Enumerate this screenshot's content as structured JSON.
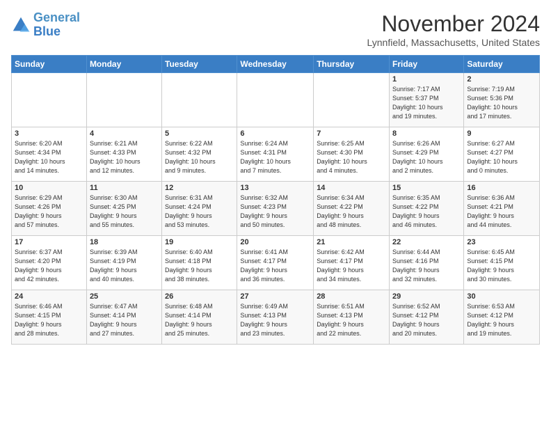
{
  "logo": {
    "line1": "General",
    "line2": "Blue"
  },
  "title": "November 2024",
  "location": "Lynnfield, Massachusetts, United States",
  "days_header": [
    "Sunday",
    "Monday",
    "Tuesday",
    "Wednesday",
    "Thursday",
    "Friday",
    "Saturday"
  ],
  "weeks": [
    [
      {
        "day": "",
        "info": ""
      },
      {
        "day": "",
        "info": ""
      },
      {
        "day": "",
        "info": ""
      },
      {
        "day": "",
        "info": ""
      },
      {
        "day": "",
        "info": ""
      },
      {
        "day": "1",
        "info": "Sunrise: 7:17 AM\nSunset: 5:37 PM\nDaylight: 10 hours\nand 19 minutes."
      },
      {
        "day": "2",
        "info": "Sunrise: 7:19 AM\nSunset: 5:36 PM\nDaylight: 10 hours\nand 17 minutes."
      }
    ],
    [
      {
        "day": "3",
        "info": "Sunrise: 6:20 AM\nSunset: 4:34 PM\nDaylight: 10 hours\nand 14 minutes."
      },
      {
        "day": "4",
        "info": "Sunrise: 6:21 AM\nSunset: 4:33 PM\nDaylight: 10 hours\nand 12 minutes."
      },
      {
        "day": "5",
        "info": "Sunrise: 6:22 AM\nSunset: 4:32 PM\nDaylight: 10 hours\nand 9 minutes."
      },
      {
        "day": "6",
        "info": "Sunrise: 6:24 AM\nSunset: 4:31 PM\nDaylight: 10 hours\nand 7 minutes."
      },
      {
        "day": "7",
        "info": "Sunrise: 6:25 AM\nSunset: 4:30 PM\nDaylight: 10 hours\nand 4 minutes."
      },
      {
        "day": "8",
        "info": "Sunrise: 6:26 AM\nSunset: 4:29 PM\nDaylight: 10 hours\nand 2 minutes."
      },
      {
        "day": "9",
        "info": "Sunrise: 6:27 AM\nSunset: 4:27 PM\nDaylight: 10 hours\nand 0 minutes."
      }
    ],
    [
      {
        "day": "10",
        "info": "Sunrise: 6:29 AM\nSunset: 4:26 PM\nDaylight: 9 hours\nand 57 minutes."
      },
      {
        "day": "11",
        "info": "Sunrise: 6:30 AM\nSunset: 4:25 PM\nDaylight: 9 hours\nand 55 minutes."
      },
      {
        "day": "12",
        "info": "Sunrise: 6:31 AM\nSunset: 4:24 PM\nDaylight: 9 hours\nand 53 minutes."
      },
      {
        "day": "13",
        "info": "Sunrise: 6:32 AM\nSunset: 4:23 PM\nDaylight: 9 hours\nand 50 minutes."
      },
      {
        "day": "14",
        "info": "Sunrise: 6:34 AM\nSunset: 4:22 PM\nDaylight: 9 hours\nand 48 minutes."
      },
      {
        "day": "15",
        "info": "Sunrise: 6:35 AM\nSunset: 4:22 PM\nDaylight: 9 hours\nand 46 minutes."
      },
      {
        "day": "16",
        "info": "Sunrise: 6:36 AM\nSunset: 4:21 PM\nDaylight: 9 hours\nand 44 minutes."
      }
    ],
    [
      {
        "day": "17",
        "info": "Sunrise: 6:37 AM\nSunset: 4:20 PM\nDaylight: 9 hours\nand 42 minutes."
      },
      {
        "day": "18",
        "info": "Sunrise: 6:39 AM\nSunset: 4:19 PM\nDaylight: 9 hours\nand 40 minutes."
      },
      {
        "day": "19",
        "info": "Sunrise: 6:40 AM\nSunset: 4:18 PM\nDaylight: 9 hours\nand 38 minutes."
      },
      {
        "day": "20",
        "info": "Sunrise: 6:41 AM\nSunset: 4:17 PM\nDaylight: 9 hours\nand 36 minutes."
      },
      {
        "day": "21",
        "info": "Sunrise: 6:42 AM\nSunset: 4:17 PM\nDaylight: 9 hours\nand 34 minutes."
      },
      {
        "day": "22",
        "info": "Sunrise: 6:44 AM\nSunset: 4:16 PM\nDaylight: 9 hours\nand 32 minutes."
      },
      {
        "day": "23",
        "info": "Sunrise: 6:45 AM\nSunset: 4:15 PM\nDaylight: 9 hours\nand 30 minutes."
      }
    ],
    [
      {
        "day": "24",
        "info": "Sunrise: 6:46 AM\nSunset: 4:15 PM\nDaylight: 9 hours\nand 28 minutes."
      },
      {
        "day": "25",
        "info": "Sunrise: 6:47 AM\nSunset: 4:14 PM\nDaylight: 9 hours\nand 27 minutes."
      },
      {
        "day": "26",
        "info": "Sunrise: 6:48 AM\nSunset: 4:14 PM\nDaylight: 9 hours\nand 25 minutes."
      },
      {
        "day": "27",
        "info": "Sunrise: 6:49 AM\nSunset: 4:13 PM\nDaylight: 9 hours\nand 23 minutes."
      },
      {
        "day": "28",
        "info": "Sunrise: 6:51 AM\nSunset: 4:13 PM\nDaylight: 9 hours\nand 22 minutes."
      },
      {
        "day": "29",
        "info": "Sunrise: 6:52 AM\nSunset: 4:12 PM\nDaylight: 9 hours\nand 20 minutes."
      },
      {
        "day": "30",
        "info": "Sunrise: 6:53 AM\nSunset: 4:12 PM\nDaylight: 9 hours\nand 19 minutes."
      }
    ]
  ]
}
